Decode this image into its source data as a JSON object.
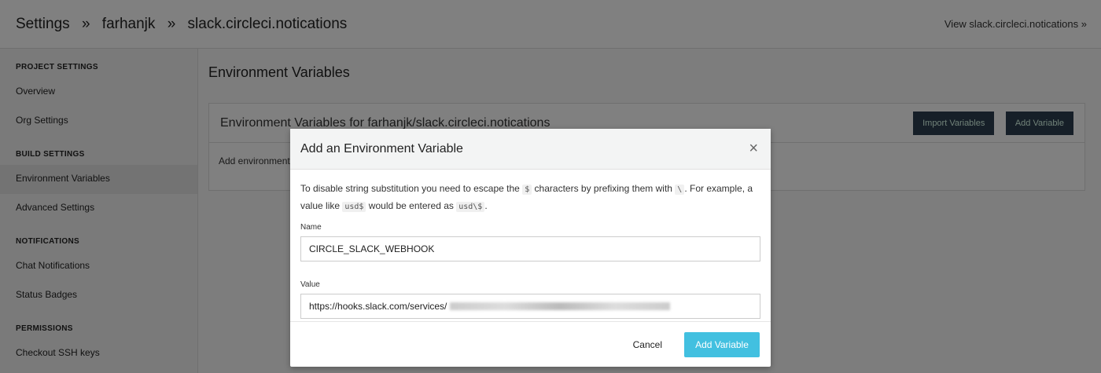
{
  "header": {
    "crumbs": [
      "Settings",
      "»",
      "farhanjk",
      "»",
      "slack.circleci.notications"
    ],
    "view_link": "View slack.circleci.notications »"
  },
  "sidebar": {
    "sections": [
      {
        "title": "PROJECT SETTINGS",
        "items": [
          "Overview",
          "Org Settings"
        ]
      },
      {
        "title": "BUILD SETTINGS",
        "items": [
          "Environment Variables",
          "Advanced Settings"
        ]
      },
      {
        "title": "NOTIFICATIONS",
        "items": [
          "Chat Notifications",
          "Status Badges"
        ]
      },
      {
        "title": "PERMISSIONS",
        "items": [
          "Checkout SSH keys"
        ]
      }
    ],
    "active": "Environment Variables"
  },
  "main": {
    "title": "Environment Variables",
    "panel_title": "Environment Variables for farhanjk/slack.circleci.notications",
    "import_label": "Import Variables",
    "add_label": "Add Variable",
    "body_text": "Add environment variables to the build."
  },
  "modal": {
    "title": "Add an Environment Variable",
    "close": "×",
    "desc": {
      "p1": "To disable string substitution you need to escape the ",
      "c1": "$",
      "p2": " characters by prefixing them with ",
      "c2": "\\",
      "p3": ". For example, a value like ",
      "c3": "usd$",
      "p4": " would be entered as ",
      "c4": "usd\\$",
      "p5": "."
    },
    "name_label": "Name",
    "name_value": "CIRCLE_SLACK_WEBHOOK",
    "value_label": "Value",
    "value_value": "https://hooks.slack.com/services/",
    "cancel": "Cancel",
    "submit": "Add Variable"
  },
  "colors": {
    "accent": "#42c0e0",
    "dark_button": "#2d3e4f"
  }
}
